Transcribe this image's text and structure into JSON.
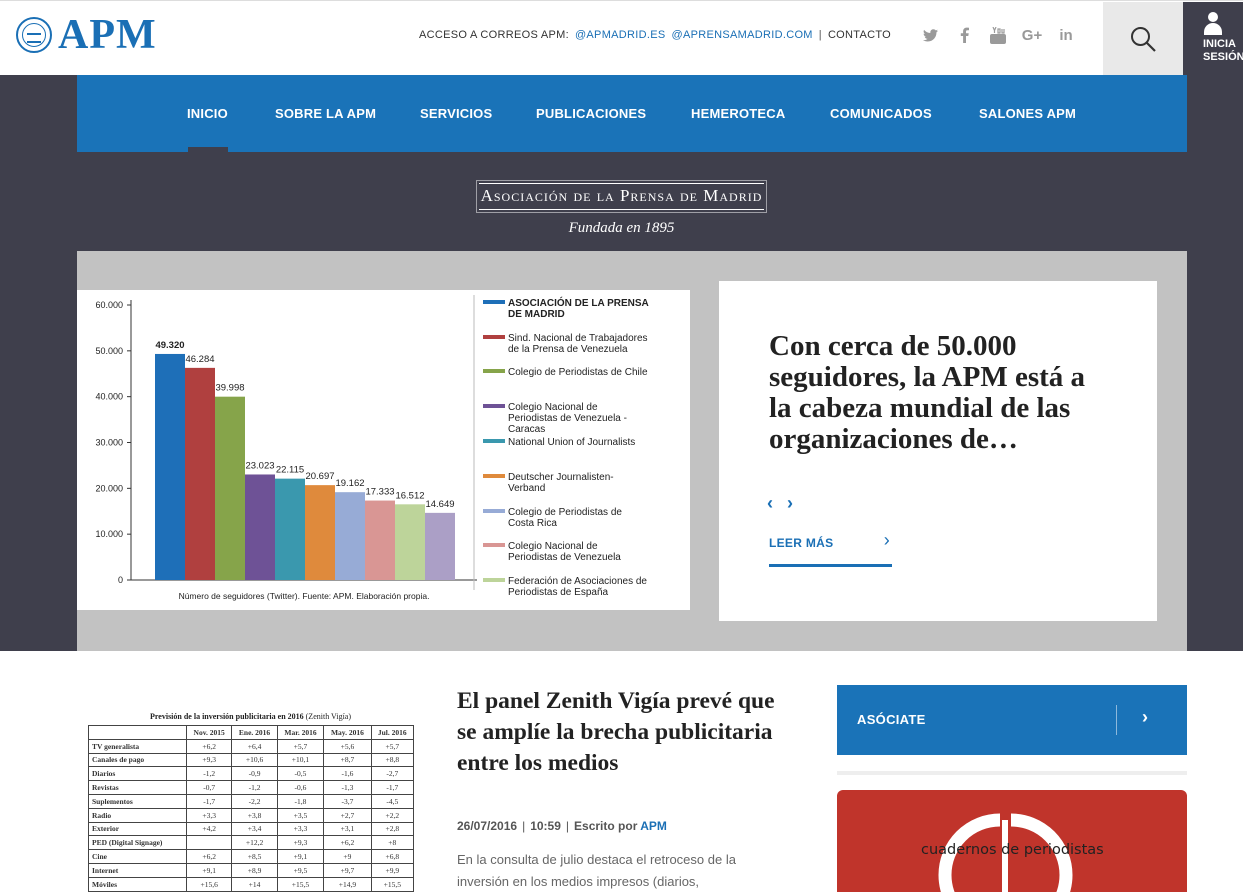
{
  "header": {
    "logo_text": "APM",
    "mail_label": "ACCESO A CORREOS APM:",
    "mail_links": [
      "@APMADRID.ES",
      "@APRENSAMADRID.COM"
    ],
    "contact_label": "CONTACTO",
    "social_icons": [
      "twitter-icon",
      "facebook-icon",
      "youtube-icon",
      "google-plus-icon",
      "linkedin-icon"
    ],
    "login_label_1": "INICIA",
    "login_label_2": "SESIÓN"
  },
  "nav": {
    "items": [
      "INICIO",
      "SOBRE LA APM",
      "SERVICIOS",
      "PUBLICACIONES",
      "HEMEROTECA",
      "COMUNICADOS",
      "SALONES APM"
    ],
    "active": "INICIO"
  },
  "masthead": {
    "title": "Asociación de la Prensa de Madrid",
    "subtitle": "Fundada en 1895"
  },
  "slide": {
    "title": "Con cerca de 50.000 seguidores, la APM está a la cabeza mundial de las organizaciones de…",
    "prev": "‹",
    "next": "›",
    "read_more": "LEER MÁS"
  },
  "chart_data": {
    "type": "bar",
    "caption": "Número de seguidores (Twitter). Fuente: APM. Elaboración propia.",
    "ylim": [
      0,
      60000
    ],
    "yticks": [
      "0",
      "10.000",
      "20.000",
      "30.000",
      "40.000",
      "50.000",
      "60.000"
    ],
    "grid": false,
    "legend_position": "right",
    "series": [
      {
        "name": "ASOCIACIÓN DE LA PRENSA DE MADRID",
        "value": 49320,
        "label": "49.320",
        "color": "#1e6fb8"
      },
      {
        "name": "Sind. Nacional de Trabajadores de la Prensa de Venezuela",
        "value": 46284,
        "label": "46.284",
        "color": "#b0403f"
      },
      {
        "name": "Colegio de Periodistas de Chile",
        "value": 39998,
        "label": "39.998",
        "color": "#86a44a"
      },
      {
        "name": "Colegio Nacional de Periodistas de Venezuela - Caracas",
        "value": 23023,
        "label": "23.023",
        "color": "#6e5296"
      },
      {
        "name": "National Union of Journalists",
        "value": 22115,
        "label": "22.115",
        "color": "#3a98ae"
      },
      {
        "name": "Deutscher Journalisten-Verband",
        "value": 20697,
        "label": "20.697",
        "color": "#df8a3c"
      },
      {
        "name": "Colegio de Periodistas de Costa Rica",
        "value": 19162,
        "label": "19.162",
        "color": "#97abd6"
      },
      {
        "name": "Colegio Nacional de Periodistas de Venezuela",
        "value": 17333,
        "label": "17.333",
        "color": "#d99694"
      },
      {
        "name": "Federación de Asociaciones de Periodistas de España",
        "value": 16512,
        "label": "16.512",
        "color": "#bdd49a"
      },
      {
        "name": "",
        "value": 14649,
        "label": "14.649",
        "color": "#ab9fc6"
      }
    ],
    "legend": [
      {
        "lines": [
          "ASOCIACIÓN DE LA PRENSA",
          "DE MADRID"
        ],
        "color": "#1e6fb8",
        "bold": true
      },
      {
        "lines": [
          "Sind. Nacional de Trabajadores",
          "de la Prensa de Venezuela"
        ],
        "color": "#b0403f"
      },
      {
        "lines": [
          "Colegio de Periodistas de Chile"
        ],
        "color": "#86a44a"
      },
      {
        "lines": [
          "Colegio Nacional de",
          "Periodistas de Venezuela -",
          "Caracas"
        ],
        "color": "#6e5296"
      },
      {
        "lines": [
          "National Union of Journalists"
        ],
        "color": "#3a98ae"
      },
      {
        "lines": [
          "Deutscher Journalisten-",
          "Verband"
        ],
        "color": "#df8a3c"
      },
      {
        "lines": [
          "Colegio de Periodistas de",
          "Costa Rica"
        ],
        "color": "#97abd6"
      },
      {
        "lines": [
          "Colegio Nacional de",
          "Periodistas de Venezuela"
        ],
        "color": "#d99694"
      },
      {
        "lines": [
          "Federación de Asociaciones de",
          "Periodistas de España"
        ],
        "color": "#bdd49a"
      }
    ]
  },
  "article": {
    "title": "El panel Zenith Vigía prevé que se amplíe la brecha publicitaria entre los medios",
    "date": "26/07/2016",
    "time": "10:59",
    "written_by": "Escrito por",
    "author": "APM",
    "excerpt": "En la consulta de julio destaca el retroceso de la inversión en los medios impresos (diarios,"
  },
  "thumb_table": {
    "title": "Previsión de la inversión publicitaria en 2016",
    "title_source": "(Zenith Vigía)",
    "headers": [
      "",
      "Nov. 2015",
      "Ene. 2016",
      "Mar. 2016",
      "May. 2016",
      "Jul. 2016"
    ],
    "rows": [
      [
        "TV generalista",
        "+6,2",
        "+6,4",
        "+5,7",
        "+5,6",
        "+5,7"
      ],
      [
        "Canales de pago",
        "+9,3",
        "+10,6",
        "+10,1",
        "+8,7",
        "+8,8"
      ],
      [
        "Diarios",
        "-1,2",
        "-0,9",
        "-0,5",
        "-1,6",
        "-2,7"
      ],
      [
        "Revistas",
        "-0,7",
        "-1,2",
        "-0,6",
        "-1,3",
        "-1,7"
      ],
      [
        "Suplementos",
        "-1,7",
        "-2,2",
        "-1,8",
        "-3,7",
        "-4,5"
      ],
      [
        "Radio",
        "+3,3",
        "+3,8",
        "+3,5",
        "+2,7",
        "+2,2"
      ],
      [
        "Exterior",
        "+4,2",
        "+3,4",
        "+3,3",
        "+3,1",
        "+2,8"
      ],
      [
        "PED (Digital Signage)",
        "",
        "+12,2",
        "+9,3",
        "+6,2",
        "+8"
      ],
      [
        "Cine",
        "+6,2",
        "+8,5",
        "+9,1",
        "+9",
        "+6,8"
      ],
      [
        "Internet",
        "+9,1",
        "+8,9",
        "+9,5",
        "+9,7",
        "+9,9"
      ],
      [
        "Móviles",
        "+15,6",
        "+14",
        "+15,5",
        "+14,9",
        "+15,5"
      ]
    ]
  },
  "sidebar": {
    "join_label": "ASÓCIATE",
    "cuadernos_text": "cuadernos de periodistas"
  },
  "colors": {
    "brand_blue": "#1a73b8",
    "dark_bg": "#3f3f4c",
    "slider_bg": "#c2c2c2",
    "cuadernos_red": "#c0342b"
  }
}
